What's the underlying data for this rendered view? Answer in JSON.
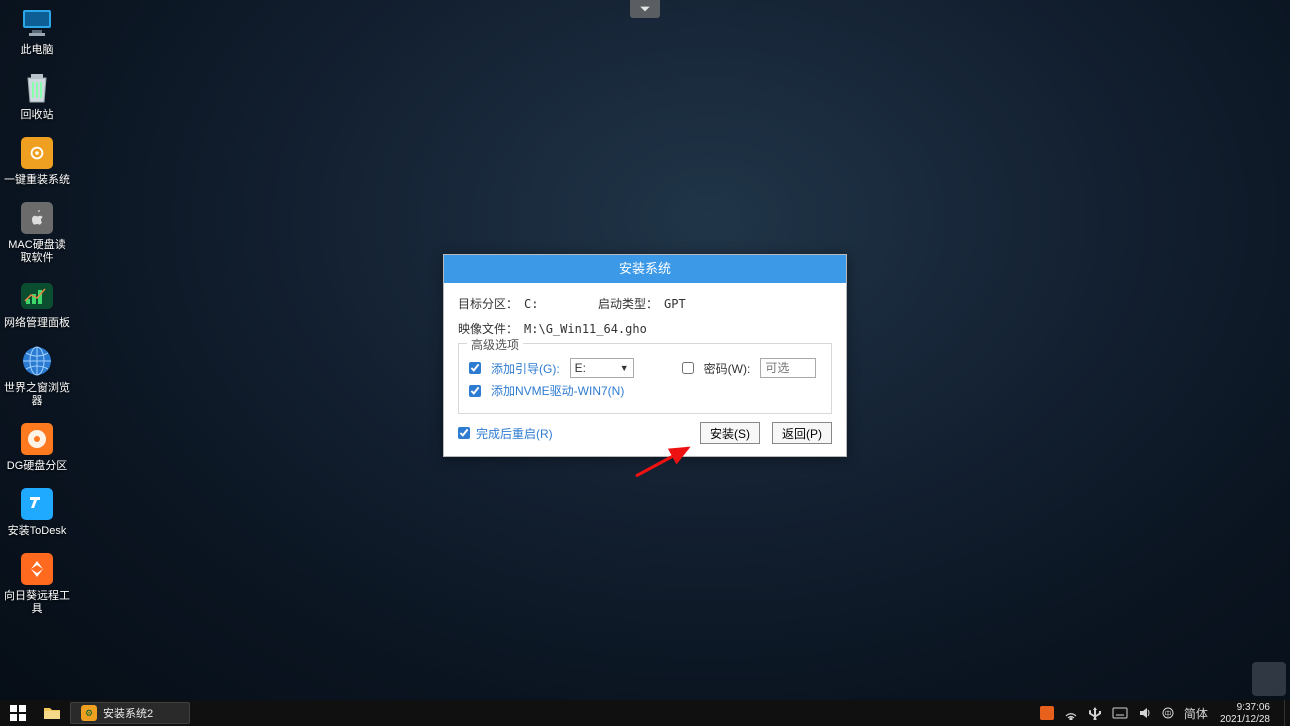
{
  "desktop": {
    "icons": [
      {
        "name": "this-pc",
        "label": "此电脑"
      },
      {
        "name": "recycle-bin",
        "label": "回收站"
      },
      {
        "name": "one-key-install",
        "label": "一键重装系统"
      },
      {
        "name": "mac-disk-read",
        "label": "MAC硬盘读\n取软件"
      },
      {
        "name": "net-admin-panel",
        "label": "网络管理面板"
      },
      {
        "name": "world-browser",
        "label": "世界之窗浏览\n器"
      },
      {
        "name": "dg-partition",
        "label": "DG硬盘分区"
      },
      {
        "name": "install-todesk",
        "label": "安装ToDesk"
      },
      {
        "name": "sunflower-remote",
        "label": "向日葵远程工\n具"
      }
    ]
  },
  "dialog": {
    "title": "安装系统",
    "target_partition_label": "目标分区：",
    "target_partition_value": "C:",
    "boot_type_label": "启动类型：",
    "boot_type_value": "GPT",
    "image_file_label": "映像文件：",
    "image_file_value": "M:\\G_Win11_64.gho",
    "advanced_legend": "高级选项",
    "add_boot_label": "添加引导(G):",
    "add_boot_checked": true,
    "boot_drive_value": "E:",
    "password_label": "密码(W):",
    "password_checked": false,
    "password_placeholder": "可选",
    "nvme_label": "添加NVME驱动-WIN7(N)",
    "nvme_checked": true,
    "reboot_label": "完成后重启(R)",
    "reboot_checked": true,
    "install_btn": "安装(S)",
    "back_btn": "返回(P)"
  },
  "taskbar": {
    "task1": "安装系统2",
    "ime": "简体",
    "time": "9:37:06",
    "date": "2021/12/28"
  }
}
